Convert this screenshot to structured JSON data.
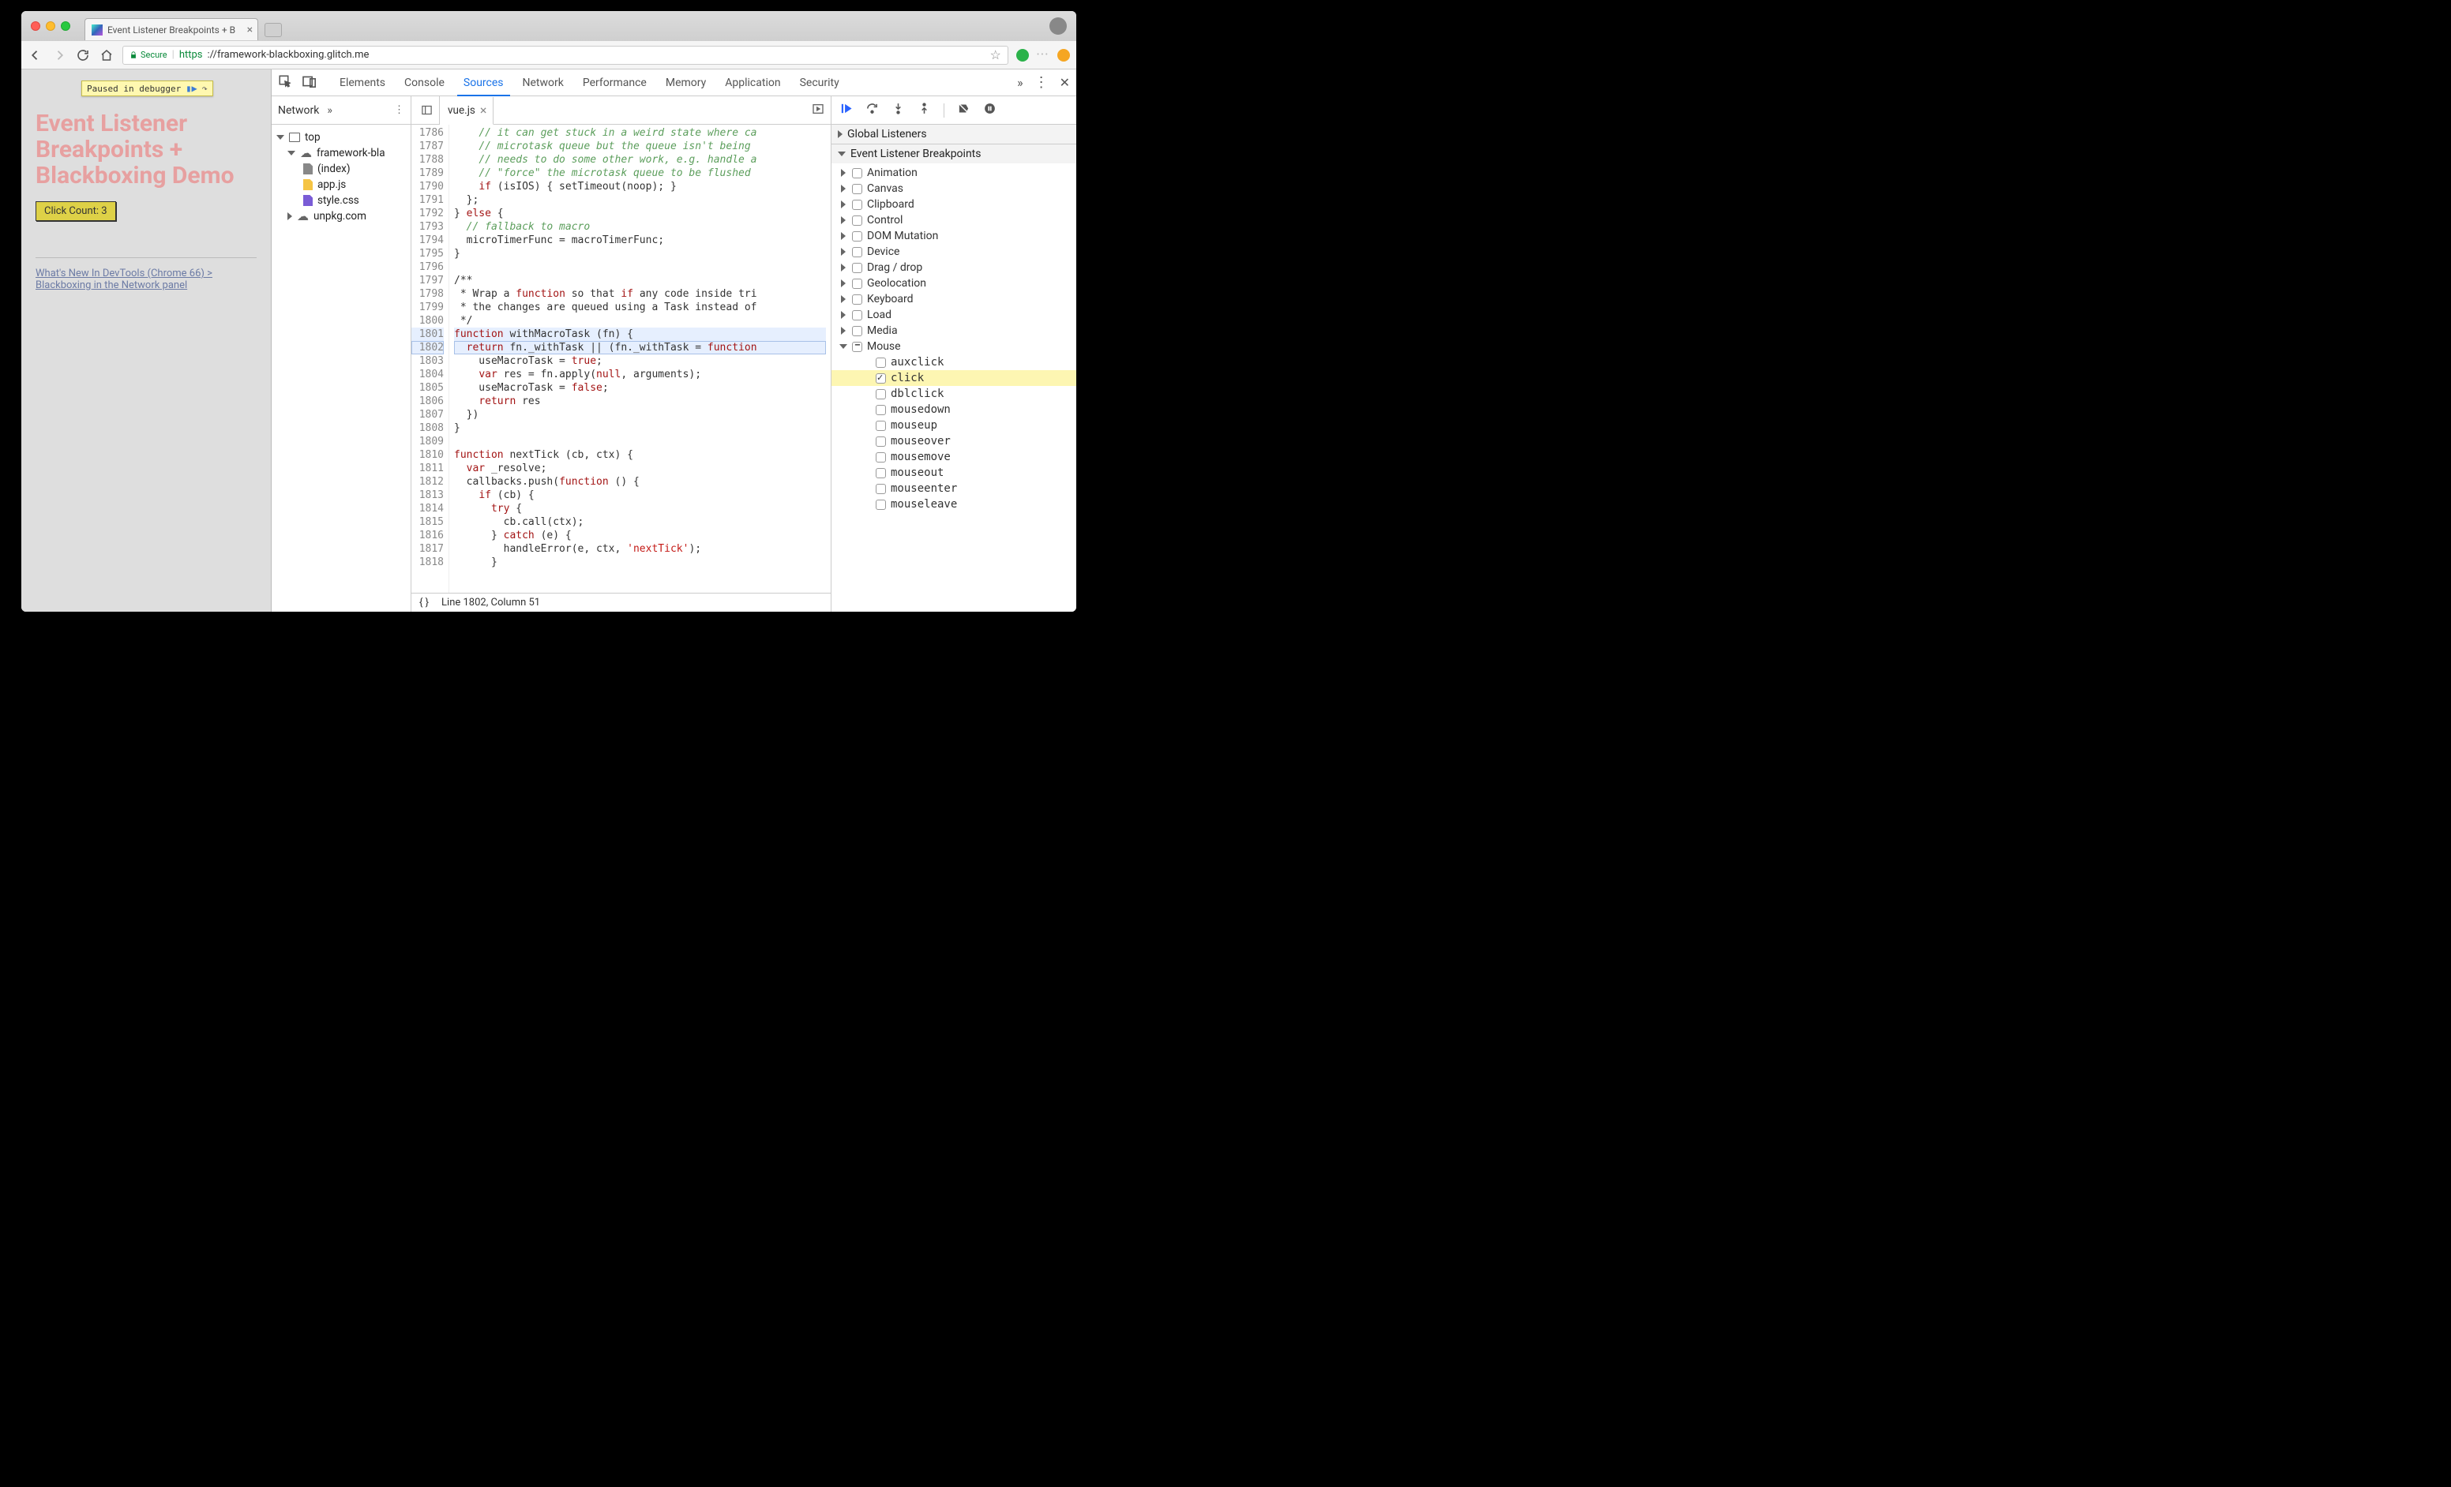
{
  "chrome": {
    "tab_title": "Event Listener Breakpoints + B",
    "secure_label": "Secure",
    "url_scheme": "https",
    "url_rest": "://framework-blackboxing.glitch.me"
  },
  "page": {
    "pause_text": "Paused in debugger",
    "heading": "Event Listener Breakpoints + Blackboxing Demo",
    "button_label": "Click Count: 3",
    "link_text": "What's New In DevTools (Chrome 66) > Blackboxing in the Network panel"
  },
  "devtools": {
    "tabs": [
      "Elements",
      "Console",
      "Sources",
      "Network",
      "Performance",
      "Memory",
      "Application",
      "Security"
    ],
    "active_tab": "Sources"
  },
  "navigator": {
    "header": "Network",
    "top": "top",
    "domain": "framework-bla",
    "files": [
      "(index)",
      "app.js",
      "style.css"
    ],
    "external": "unpkg.com"
  },
  "editor": {
    "file_tab": "vue.js",
    "code_lines": {
      "1786": "    // it can get stuck in a weird state where ca",
      "1787": "    // microtask queue but the queue isn't being ",
      "1788": "    // needs to do some other work, e.g. handle a",
      "1789": "    // \"force\" the microtask queue to be flushed ",
      "1790": "    if (isIOS) { setTimeout(noop); }",
      "1791": "  };",
      "1792": "} else {",
      "1793": "  // fallback to macro",
      "1794": "  microTimerFunc = macroTimerFunc;",
      "1795": "}",
      "1796": "",
      "1797": "/**",
      "1798": " * Wrap a function so that if any code inside tri",
      "1799": " * the changes are queued using a Task instead of",
      "1800": " */",
      "1801": "function withMacroTask (fn) {",
      "1802": "  return fn._withTask || (fn._withTask = function",
      "1803": "    useMacroTask = true;",
      "1804": "    var res = fn.apply(null, arguments);",
      "1805": "    useMacroTask = false;",
      "1806": "    return res",
      "1807": "  })",
      "1808": "}",
      "1809": "",
      "1810": "function nextTick (cb, ctx) {",
      "1811": "  var _resolve;",
      "1812": "  callbacks.push(function () {",
      "1813": "    if (cb) {",
      "1814": "      try {",
      "1815": "        cb.call(ctx);",
      "1816": "      } catch (e) {",
      "1817": "        handleError(e, ctx, 'nextTick');",
      "1818": "      }"
    },
    "status": "Line 1802, Column 51"
  },
  "sidebar": {
    "sections": {
      "global": "Global Listeners",
      "elb": "Event Listener Breakpoints"
    },
    "categories": [
      {
        "name": "Animation",
        "expanded": false,
        "checked": false
      },
      {
        "name": "Canvas",
        "expanded": false,
        "checked": false
      },
      {
        "name": "Clipboard",
        "expanded": false,
        "checked": false
      },
      {
        "name": "Control",
        "expanded": false,
        "checked": false
      },
      {
        "name": "DOM Mutation",
        "expanded": false,
        "checked": false
      },
      {
        "name": "Device",
        "expanded": false,
        "checked": false
      },
      {
        "name": "Drag / drop",
        "expanded": false,
        "checked": false
      },
      {
        "name": "Geolocation",
        "expanded": false,
        "checked": false
      },
      {
        "name": "Keyboard",
        "expanded": false,
        "checked": false
      },
      {
        "name": "Load",
        "expanded": false,
        "checked": false
      },
      {
        "name": "Media",
        "expanded": false,
        "checked": false
      },
      {
        "name": "Mouse",
        "expanded": true,
        "checked": "mixed",
        "items": [
          {
            "name": "auxclick",
            "checked": false
          },
          {
            "name": "click",
            "checked": true,
            "selected": true
          },
          {
            "name": "dblclick",
            "checked": false
          },
          {
            "name": "mousedown",
            "checked": false
          },
          {
            "name": "mouseup",
            "checked": false
          },
          {
            "name": "mouseover",
            "checked": false
          },
          {
            "name": "mousemove",
            "checked": false
          },
          {
            "name": "mouseout",
            "checked": false
          },
          {
            "name": "mouseenter",
            "checked": false
          },
          {
            "name": "mouseleave",
            "checked": false
          }
        ]
      }
    ]
  }
}
